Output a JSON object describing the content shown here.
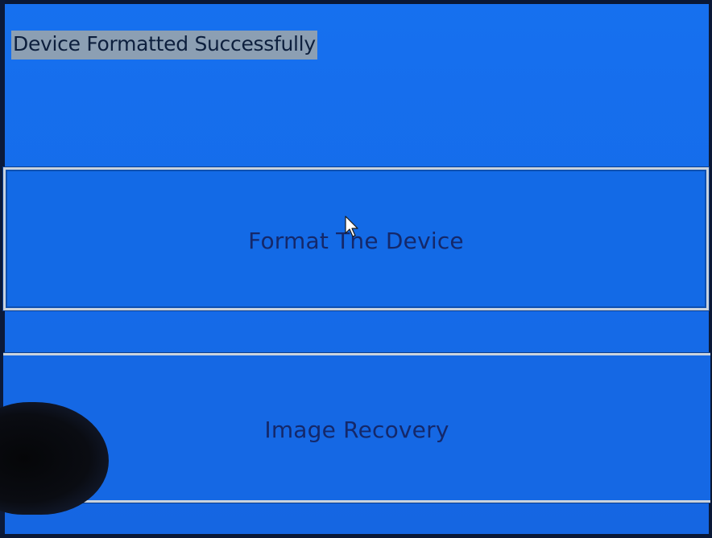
{
  "status": {
    "message": "Device Formatted Successfully"
  },
  "menu": {
    "format_label": "Format The Device",
    "recovery_label": "Image Recovery"
  },
  "colors": {
    "screen_background": "#156cea",
    "button_text": "#14286a",
    "status_highlight": "#8c9fb3",
    "button_border": "#c9d3de"
  },
  "icons": {
    "pointer": "mouse-pointer-icon"
  }
}
